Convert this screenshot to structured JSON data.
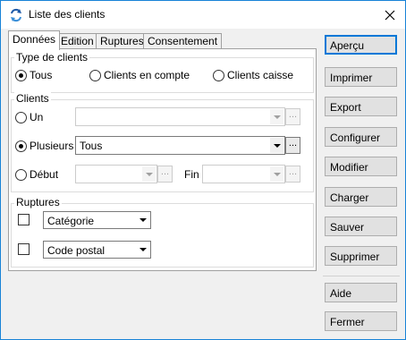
{
  "window": {
    "title": "Liste des clients",
    "icon": "sync-arrows-icon"
  },
  "tabs": [
    {
      "label": "Données",
      "active": true
    },
    {
      "label": "Edition",
      "active": false
    },
    {
      "label": "Ruptures",
      "active": false
    },
    {
      "label": "Consentement",
      "active": false
    }
  ],
  "type_clients": {
    "label": "Type de clients",
    "options": [
      {
        "label": "Tous",
        "selected": true
      },
      {
        "label": "Clients en compte",
        "selected": false
      },
      {
        "label": "Clients caisse",
        "selected": false
      }
    ]
  },
  "clients": {
    "label": "Clients",
    "un_label": "Un",
    "un_value": "",
    "plusieurs_label": "Plusieurs",
    "plusieurs_value": "Tous",
    "debut_label": "Début",
    "debut_value": "",
    "fin_label": "Fin",
    "fin_value": "",
    "selected": "Plusieurs",
    "ellipsis": "..."
  },
  "ruptures": {
    "label": "Ruptures",
    "rows": [
      {
        "checked": false,
        "value": "Catégorie"
      },
      {
        "checked": false,
        "value": "Code postal"
      }
    ]
  },
  "buttons": {
    "apercu": "Aperçu",
    "imprimer": "Imprimer",
    "export": "Export",
    "configurer": "Configurer",
    "modifier": "Modifier",
    "charger": "Charger",
    "sauver": "Sauver",
    "supprimer": "Supprimer",
    "aide": "Aide",
    "fermer": "Fermer"
  },
  "colors": {
    "accent": "#0078d7",
    "window_border": "#1883d7",
    "background": "#f0f0f0"
  }
}
